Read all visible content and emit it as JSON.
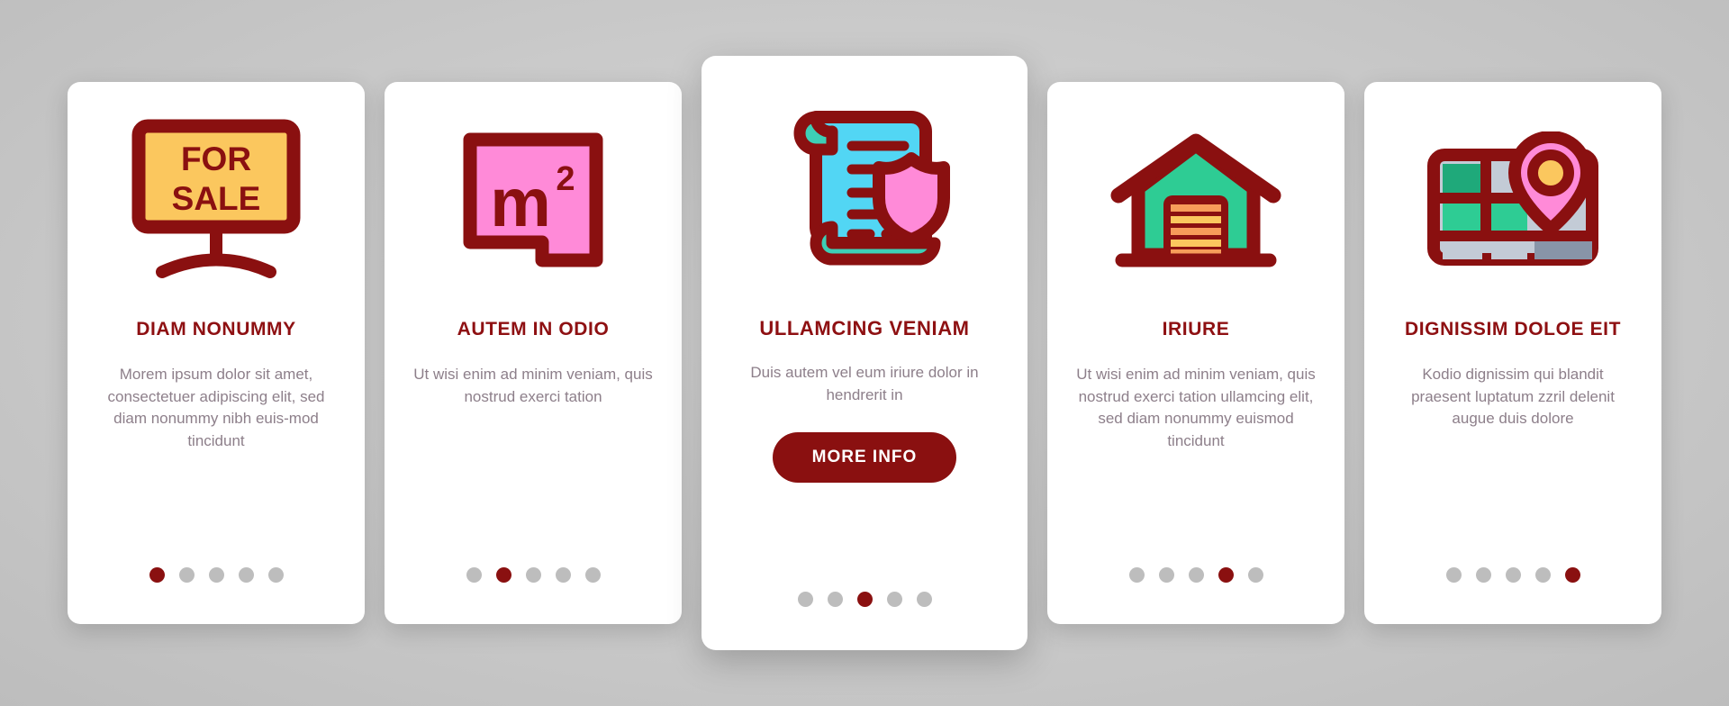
{
  "background_color": "#cccccc",
  "theme": {
    "accent_dark_red": "#8A1010",
    "title_red": "#8E1012",
    "body_text": "#8d7f8a",
    "card_background": "#ffffff",
    "dot_inactive": "#bdbdbd",
    "sign_yellow": "#FBC75E",
    "pink": "#FF8AD8",
    "cyan": "#52D6F4",
    "teal": "#3DCFB6",
    "green": "#2ECC94",
    "orange": "#F79C5A",
    "gray_blue": "#C3CBD6"
  },
  "cards": [
    {
      "id": "card-diam-nonummy",
      "icon": "for-sale-sign-icon",
      "icon_text": {
        "line1": "FOR",
        "line2": "SALE"
      },
      "title": "DIAM NONUMMY",
      "body": "Morem ipsum dolor sit amet, consectetuer adipiscing elit, sed diam nonummy nibh euis-mod tincidunt",
      "featured": false,
      "dots_total": 5,
      "dot_active_index": 0
    },
    {
      "id": "card-autem-in-odio",
      "icon": "square-meters-icon",
      "icon_text": {
        "line1": "m",
        "line2": "2"
      },
      "title": "AUTEM IN ODIO",
      "body": "Ut wisi enim ad minim veniam, quis nostrud exerci tation",
      "featured": false,
      "dots_total": 5,
      "dot_active_index": 1
    },
    {
      "id": "card-ullamcing-veniam",
      "icon": "contract-shield-icon",
      "title": "ULLAMCING VENIAM",
      "body": "Duis autem vel eum iriure dolor in hendrerit in",
      "button_label": "MORE INFO",
      "featured": true,
      "dots_total": 5,
      "dot_active_index": 2
    },
    {
      "id": "card-iriure",
      "icon": "garage-icon",
      "title": "IRIURE",
      "body": "Ut wisi enim ad minim veniam, quis nostrud exerci tation ullamcing elit, sed diam nonummy euismod tincidunt",
      "featured": false,
      "dots_total": 5,
      "dot_active_index": 3
    },
    {
      "id": "card-dignissim-doloe-eit",
      "icon": "map-location-pin-icon",
      "title": "DIGNISSIM DOLOE EIT",
      "body": "Kodio dignissim qui blandit praesent luptatum zzril delenit augue duis dolore",
      "featured": false,
      "dots_total": 5,
      "dot_active_index": 4
    }
  ]
}
